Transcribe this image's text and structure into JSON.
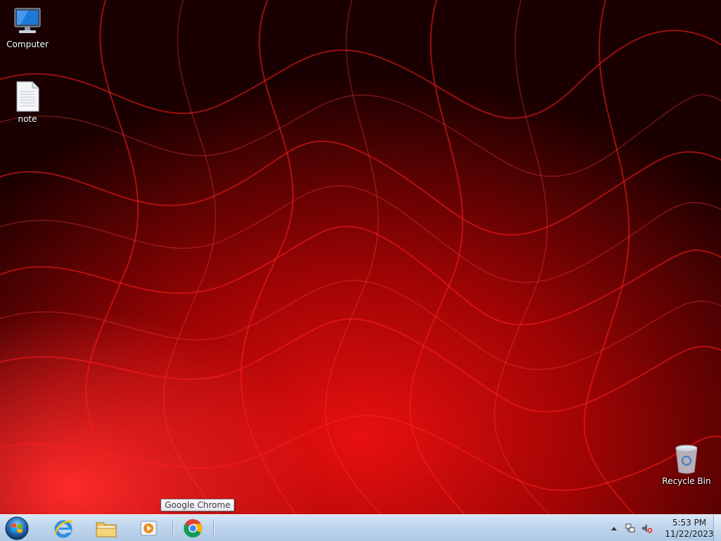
{
  "desktop": {
    "icons": [
      {
        "label": "Computer",
        "icon": "computer-icon"
      },
      {
        "label": "note",
        "icon": "text-file-icon"
      },
      {
        "label": "Recycle Bin",
        "icon": "recycle-bin-icon"
      }
    ]
  },
  "taskbar": {
    "start_icon": "windows-orb-icon",
    "pinned": [
      {
        "name": "Internet Explorer",
        "icon": "internet-explorer-icon"
      },
      {
        "name": "Windows Explorer",
        "icon": "folder-icon"
      },
      {
        "name": "Windows Media Player",
        "icon": "media-player-icon"
      },
      {
        "name": "Google Chrome",
        "icon": "chrome-icon"
      }
    ],
    "tooltip": "Google Chrome",
    "tray": {
      "icons": [
        "show-hidden-icons-icon",
        "network-icon",
        "volume-muted-icon"
      ],
      "time": "5:53 PM",
      "date": "11/22/2023"
    }
  },
  "colors": {
    "wallpaper_dark": "#140000",
    "wallpaper_red": "#e10b0b",
    "taskbar": "#bfd5ec"
  }
}
